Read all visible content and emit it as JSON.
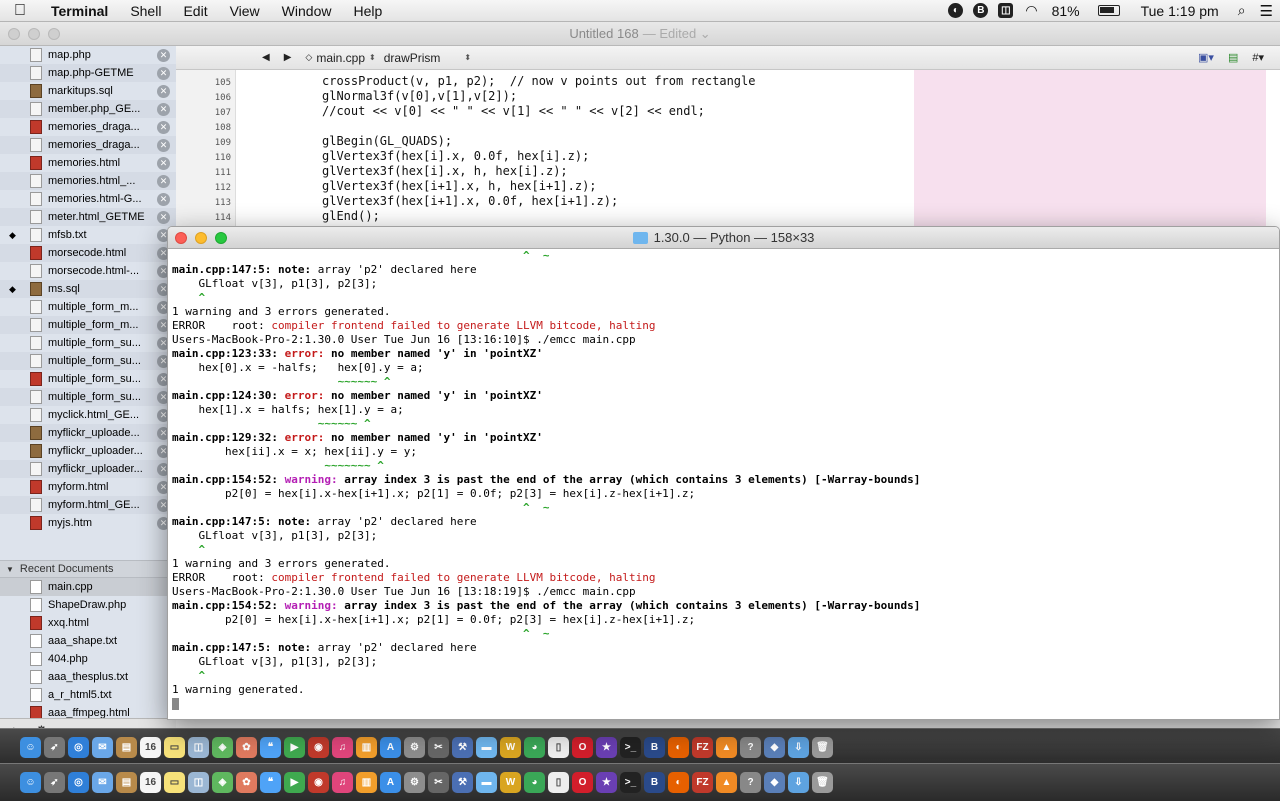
{
  "menubar": {
    "apple": "",
    "app_name": "Terminal",
    "items": [
      "Shell",
      "Edit",
      "View",
      "Window",
      "Help"
    ],
    "battery": "81%",
    "clock": "Tue 1:19 pm"
  },
  "editor": {
    "title": "Untitled 168",
    "edited": "— Edited ⌄",
    "jumpbar": {
      "file": "main.cpp",
      "function": "drawPrism"
    },
    "code_lines": [
      {
        "num": "105",
        "text": "crossProduct(v, p1, p2);  // now v points out from rectangle"
      },
      {
        "num": "106",
        "text": "glNormal3f(v[0],v[1],v[2]);"
      },
      {
        "num": "107",
        "text": "//cout << v[0] << \" \" << v[1] << \" \" << v[2] << endl;"
      },
      {
        "num": "108",
        "text": ""
      },
      {
        "num": "109",
        "text": "glBegin(GL_QUADS);"
      },
      {
        "num": "110",
        "text": "glVertex3f(hex[i].x, 0.0f, hex[i].z);"
      },
      {
        "num": "111",
        "text": "glVertex3f(hex[i].x, h, hex[i].z);"
      },
      {
        "num": "112",
        "text": "glVertex3f(hex[i+1].x, h, hex[i+1].z);"
      },
      {
        "num": "113",
        "text": "glVertex3f(hex[i+1].x, 0.0f, hex[i+1].z);"
      },
      {
        "num": "114",
        "text": "glEnd();"
      }
    ]
  },
  "sidebar": {
    "files": [
      {
        "name": "map.php",
        "icon": "doc"
      },
      {
        "name": "map.php-GETME",
        "icon": "doc"
      },
      {
        "name": "markitups.sql",
        "icon": "sql"
      },
      {
        "name": "member.php_GE...",
        "icon": "doc"
      },
      {
        "name": "memories_draga...",
        "icon": "img"
      },
      {
        "name": "memories_draga...",
        "icon": "doc"
      },
      {
        "name": "memories.html",
        "icon": "img"
      },
      {
        "name": "memories.html_...",
        "icon": "doc"
      },
      {
        "name": "memories.html-G...",
        "icon": "doc"
      },
      {
        "name": "meter.html_GETME",
        "icon": "doc"
      },
      {
        "name": "mfsb.txt",
        "icon": "doc",
        "marker": "◆"
      },
      {
        "name": "morsecode.html",
        "icon": "img"
      },
      {
        "name": "morsecode.html-...",
        "icon": "doc"
      },
      {
        "name": "ms.sql",
        "icon": "sql",
        "marker": "◆"
      },
      {
        "name": "multiple_form_m...",
        "icon": "doc"
      },
      {
        "name": "multiple_form_m...",
        "icon": "doc"
      },
      {
        "name": "multiple_form_su...",
        "icon": "doc"
      },
      {
        "name": "multiple_form_su...",
        "icon": "doc"
      },
      {
        "name": "multiple_form_su...",
        "icon": "img"
      },
      {
        "name": "multiple_form_su...",
        "icon": "doc"
      },
      {
        "name": "myclick.html_GE...",
        "icon": "doc"
      },
      {
        "name": "myflickr_uploade...",
        "icon": "sql"
      },
      {
        "name": "myflickr_uploader...",
        "icon": "sql"
      },
      {
        "name": "myflickr_uploader...",
        "icon": "doc"
      },
      {
        "name": "myform.html",
        "icon": "img"
      },
      {
        "name": "myform.html_GE...",
        "icon": "doc"
      },
      {
        "name": "myjs.htm",
        "icon": "img"
      }
    ],
    "recent_header": "Recent Documents",
    "recent": [
      {
        "name": "main.cpp",
        "icon": "doc",
        "selected": true
      },
      {
        "name": "ShapeDraw.php",
        "icon": "doc"
      },
      {
        "name": "xxq.html",
        "icon": "img"
      },
      {
        "name": "aaa_shape.txt",
        "icon": "doc"
      },
      {
        "name": "404.php",
        "icon": "doc"
      },
      {
        "name": "aaa_thesplus.txt",
        "icon": "doc"
      },
      {
        "name": "a_r_html5.txt",
        "icon": "doc"
      },
      {
        "name": "aaa_ffmpeg.html",
        "icon": "img"
      }
    ]
  },
  "terminal": {
    "title": "1.30.0 — Python — 158×33",
    "lines": [
      [
        {
          "t": "                                                     ^  ~",
          "c": "grn"
        }
      ],
      [
        {
          "t": "main.cpp:147:5: note:",
          "c": "b"
        },
        {
          "t": " array 'p2' declared here"
        }
      ],
      [
        {
          "t": "    GLfloat v[3], p1[3], p2[3];"
        }
      ],
      [
        {
          "t": "    ^",
          "c": "grn"
        }
      ],
      [
        {
          "t": "1 warning and 3 errors generated."
        }
      ],
      [
        {
          "t": "ERROR    root: "
        },
        {
          "t": "compiler frontend failed to generate LLVM bitcode, halting",
          "c": "red"
        }
      ],
      [
        {
          "t": "Users-MacBook-Pro-2:1.30.0 User Tue Jun 16 [13:16:10]$ ./emcc main.cpp"
        }
      ],
      [
        {
          "t": "main.cpp:123:33: ",
          "c": "b"
        },
        {
          "t": "error:",
          "c": "err"
        },
        {
          "t": " no member named 'y' in 'pointXZ'",
          "c": "b"
        }
      ],
      [
        {
          "t": "    hex[0].x = -halfs;   hex[0].y = a;"
        }
      ],
      [
        {
          "t": "                         ~~~~~~ ^",
          "c": "grn"
        }
      ],
      [
        {
          "t": "main.cpp:124:30: ",
          "c": "b"
        },
        {
          "t": "error:",
          "c": "err"
        },
        {
          "t": " no member named 'y' in 'pointXZ'",
          "c": "b"
        }
      ],
      [
        {
          "t": "    hex[1].x = halfs; hex[1].y = a;"
        }
      ],
      [
        {
          "t": "                      ~~~~~~ ^",
          "c": "grn"
        }
      ],
      [
        {
          "t": "main.cpp:129:32: ",
          "c": "b"
        },
        {
          "t": "error:",
          "c": "err"
        },
        {
          "t": " no member named 'y' in 'pointXZ'",
          "c": "b"
        }
      ],
      [
        {
          "t": "        hex[ii].x = x; hex[ii].y = y;"
        }
      ],
      [
        {
          "t": "                       ~~~~~~~ ^",
          "c": "grn"
        }
      ],
      [
        {
          "t": "main.cpp:154:52: ",
          "c": "b"
        },
        {
          "t": "warning:",
          "c": "warn"
        },
        {
          "t": " array index 3 is past the end of the array (which contains 3 elements) [-Warray-bounds]",
          "c": "b"
        }
      ],
      [
        {
          "t": "        p2[0] = hex[i].x-hex[i+1].x; p2[1] = 0.0f; p2[3] = hex[i].z-hex[i+1].z;"
        }
      ],
      [
        {
          "t": "                                                     ^  ~",
          "c": "grn"
        }
      ],
      [
        {
          "t": "main.cpp:147:5: note:",
          "c": "b"
        },
        {
          "t": " array 'p2' declared here"
        }
      ],
      [
        {
          "t": "    GLfloat v[3], p1[3], p2[3];"
        }
      ],
      [
        {
          "t": "    ^",
          "c": "grn"
        }
      ],
      [
        {
          "t": "1 warning and 3 errors generated."
        }
      ],
      [
        {
          "t": "ERROR    root: "
        },
        {
          "t": "compiler frontend failed to generate LLVM bitcode, halting",
          "c": "red"
        }
      ],
      [
        {
          "t": "Users-MacBook-Pro-2:1.30.0 User Tue Jun 16 [13:18:19]$ ./emcc main.cpp"
        }
      ],
      [
        {
          "t": "main.cpp:154:52: ",
          "c": "b"
        },
        {
          "t": "warning:",
          "c": "warn"
        },
        {
          "t": " array index 3 is past the end of the array (which contains 3 elements) [-Warray-bounds]",
          "c": "b"
        }
      ],
      [
        {
          "t": "        p2[0] = hex[i].x-hex[i+1].x; p2[1] = 0.0f; p2[3] = hex[i].z-hex[i+1].z;"
        }
      ],
      [
        {
          "t": "                                                     ^  ~",
          "c": "grn"
        }
      ],
      [
        {
          "t": "main.cpp:147:5: note:",
          "c": "b"
        },
        {
          "t": " array 'p2' declared here"
        }
      ],
      [
        {
          "t": "    GLfloat v[3], p1[3], p2[3];"
        }
      ],
      [
        {
          "t": "    ^",
          "c": "grn"
        }
      ],
      [
        {
          "t": "1 warning generated."
        }
      ]
    ]
  },
  "dock": {
    "icons": [
      {
        "name": "finder-icon",
        "color": "#3d8fe0",
        "glyph": "☺"
      },
      {
        "name": "launchpad-icon",
        "color": "#777777",
        "glyph": "➶"
      },
      {
        "name": "safari-icon",
        "color": "#2f7fd8",
        "glyph": "◎"
      },
      {
        "name": "mail-icon",
        "color": "#6aa7e8",
        "glyph": "✉"
      },
      {
        "name": "contacts-icon",
        "color": "#b88a4a",
        "glyph": "▤"
      },
      {
        "name": "calendar-icon",
        "color": "#f5f5f5",
        "glyph": "16"
      },
      {
        "name": "notes-icon",
        "color": "#f7e27a",
        "glyph": "▭"
      },
      {
        "name": "preview-icon",
        "color": "#9bb7d4",
        "glyph": "◫"
      },
      {
        "name": "maps-icon",
        "color": "#5fb85f",
        "glyph": "◈"
      },
      {
        "name": "photos-icon",
        "color": "#e07a5f",
        "glyph": "✿"
      },
      {
        "name": "messages-icon",
        "color": "#4fa3f7",
        "glyph": "❝"
      },
      {
        "name": "facetime-icon",
        "color": "#3fa94f",
        "glyph": "▶"
      },
      {
        "name": "photobooth-icon",
        "color": "#c0392b",
        "glyph": "◉"
      },
      {
        "name": "itunes-icon",
        "color": "#e0457b",
        "glyph": "♫"
      },
      {
        "name": "ibooks-icon",
        "color": "#f29e2b",
        "glyph": "▥"
      },
      {
        "name": "appstore-icon",
        "color": "#3b8fe8",
        "glyph": "A"
      },
      {
        "name": "system-preferences-icon",
        "color": "#8d8d8d",
        "glyph": "⚙"
      },
      {
        "name": "utility-icon",
        "color": "#666666",
        "glyph": "✂"
      },
      {
        "name": "xcode-icon",
        "color": "#4b6fb3",
        "glyph": "⚒"
      },
      {
        "name": "folder-icon",
        "color": "#6fb6ee",
        "glyph": "▬"
      },
      {
        "name": "filezilla-icon",
        "color": "#d9a521",
        "glyph": "W"
      },
      {
        "name": "chrome-icon",
        "color": "#3aa757",
        "glyph": "◕"
      },
      {
        "name": "textedit-icon",
        "color": "#eeeeee",
        "glyph": "▯"
      },
      {
        "name": "opera-icon",
        "color": "#d21e2b",
        "glyph": "O"
      },
      {
        "name": "imovie-icon",
        "color": "#6a3fb3",
        "glyph": "★"
      },
      {
        "name": "terminal-icon",
        "color": "#222222",
        "glyph": ">_"
      },
      {
        "name": "bbedit-icon",
        "color": "#2a4a8a",
        "glyph": "B"
      },
      {
        "name": "firefox-icon",
        "color": "#e66000",
        "glyph": "◐"
      },
      {
        "name": "ftp-icon",
        "color": "#c0392b",
        "glyph": "FZ"
      },
      {
        "name": "vlc-icon",
        "color": "#f08a24",
        "glyph": "▲"
      },
      {
        "name": "help-icon",
        "color": "#888888",
        "glyph": "?"
      },
      {
        "name": "virtualbox-icon",
        "color": "#5a7fb8",
        "glyph": "◆"
      },
      {
        "name": "downloads-icon",
        "color": "#5ea3e0",
        "glyph": "⇩"
      },
      {
        "name": "trash-icon",
        "color": "#9a9a9a",
        "glyph": "🗑"
      }
    ]
  }
}
